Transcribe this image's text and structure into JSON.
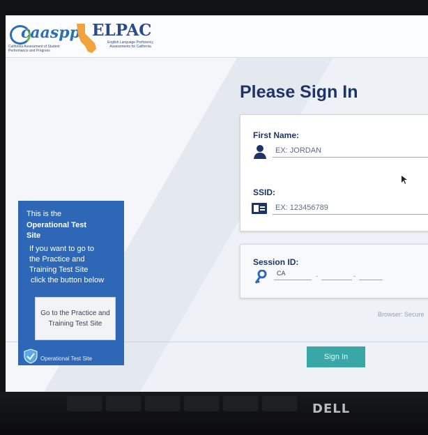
{
  "header": {
    "caaspp_logo": "caaspp",
    "caaspp_tagline": "California Assessment of Student Performance and Progress",
    "elpac_logo": "ELPAC",
    "elpac_tagline": "English Language Proficiency Assessments for California"
  },
  "signin": {
    "title": "Please Sign In",
    "first_name_label": "First Name:",
    "first_name_placeholder": "EX: JORDAN",
    "ssid_label": "SSID:",
    "ssid_placeholder": "EX: 123456789",
    "session_label": "Session ID:",
    "session_prefix": "CA",
    "session_separator": "-",
    "button_label": "Sign In",
    "browser_status": "Browser: Secure"
  },
  "side_panel": {
    "line1": "This is the",
    "line2": "Operational Test",
    "line3": "Site",
    "line4": "If you want to go to",
    "line5": "the Practice and",
    "line6": "Training Test Site",
    "line7": "click the button below",
    "button_label": "Go to the Practice and Training Test Site",
    "footer_label": "Operational Test Site"
  },
  "device": {
    "brand": "DELL"
  },
  "colors": {
    "primary": "#1e3468",
    "panel": "#2d67b6",
    "signin_button": "#39a7a6"
  },
  "icons": [
    "person-icon",
    "id-card-icon",
    "key-icon",
    "shield-check-icon"
  ]
}
